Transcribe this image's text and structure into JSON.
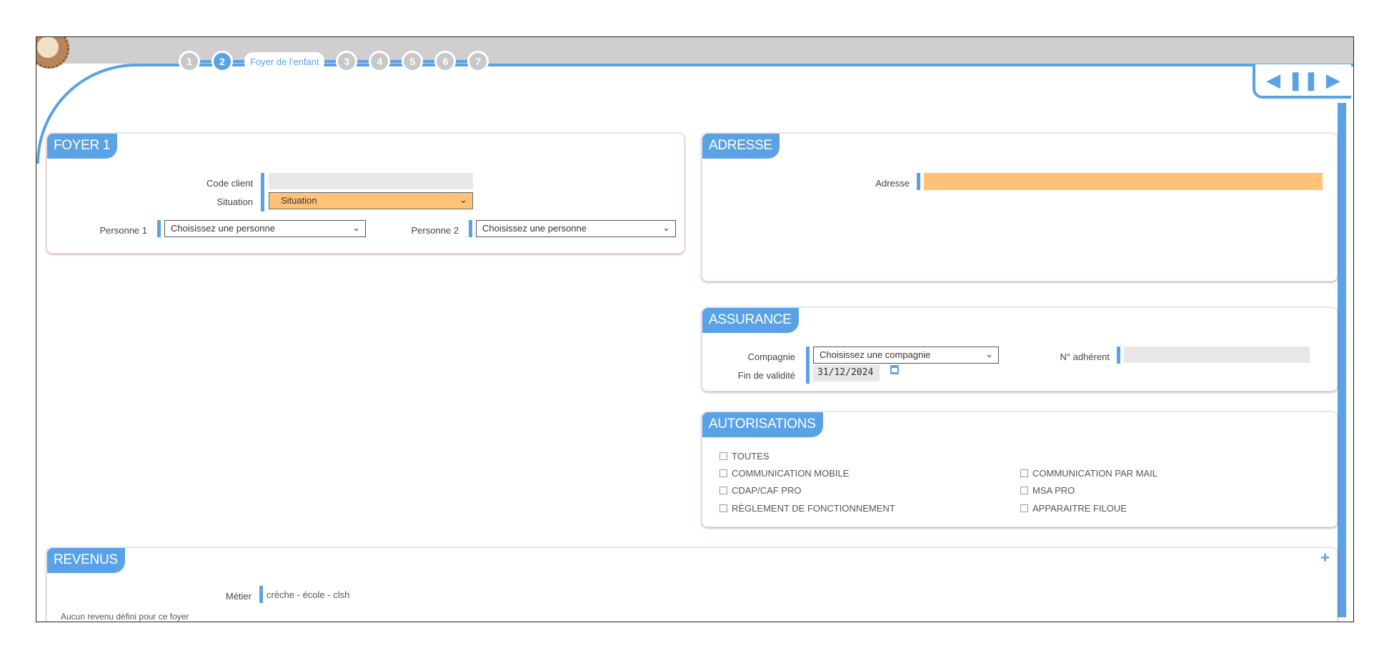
{
  "wizard": {
    "steps": [
      {
        "number": "1"
      },
      {
        "number": "2",
        "label": "Foyer de l'enfant"
      },
      {
        "number": "3"
      },
      {
        "number": "4"
      },
      {
        "number": "5"
      },
      {
        "number": "6"
      },
      {
        "number": "7"
      }
    ],
    "nav": {
      "prev": "◀",
      "pause": "❚❚",
      "next": "▶"
    }
  },
  "foyer": {
    "title": "FOYER 1",
    "code_client_label": "Code client",
    "code_client_value": "",
    "situation_label": "Situation",
    "situation_value": "Situation",
    "personne1_label": "Personne 1",
    "personne1_value": "Choisissez une personne",
    "personne2_label": "Personne 2",
    "personne2_value": "Choisissez une personne"
  },
  "adresse": {
    "title": "ADRESSE",
    "adresse_label": "Adresse",
    "adresse_value": ""
  },
  "assurance": {
    "title": "ASSURANCE",
    "compagnie_label": "Compagnie",
    "compagnie_value": "Choisissez une compagnie",
    "adherent_label": "N° adhérent",
    "adherent_value": "",
    "fin_label": "Fin de validité",
    "fin_value": "31/12/2024"
  },
  "autorisations": {
    "title": "AUTORISATIONS",
    "items": [
      "TOUTES",
      "COMMUNICATION MOBILE",
      "COMMUNICATION PAR MAIL",
      "CDAP/CAF PRO",
      "MSA PRO",
      "RÈGLEMENT DE FONCTIONNEMENT",
      "APPARAITRE FILOUE"
    ]
  },
  "revenus": {
    "title": "REVENUS",
    "add_label": "+",
    "metier_label": "Métier",
    "metier_value": "crèche - école - clsh",
    "empty_text": "Aucun revenu défini pour ce foyer"
  },
  "colors": {
    "accent": "#5aa2e6",
    "required": "#ffc278",
    "readonly": "#e8e8e8"
  },
  "icons": [
    "logo-icon",
    "chevron-down-icon",
    "calendar-icon",
    "prev-icon",
    "pause-icon",
    "next-icon",
    "plus-icon"
  ]
}
